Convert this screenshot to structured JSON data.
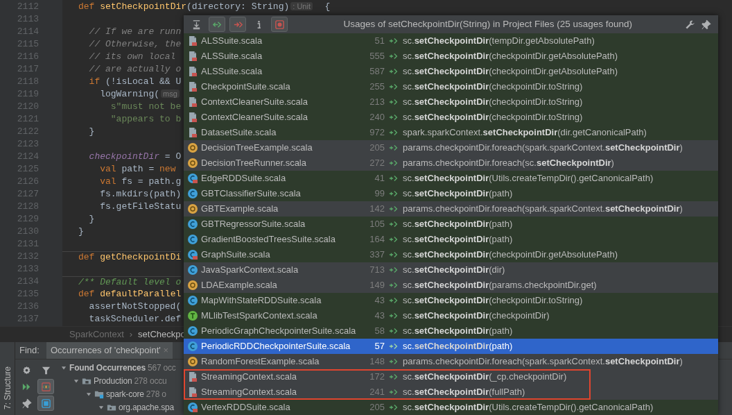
{
  "editor": {
    "lines": [
      {
        "number": "2112",
        "segments": [
          {
            "kind": "keyword",
            "text": "def "
          },
          {
            "kind": "function",
            "text": "setCheckpointDir"
          },
          {
            "kind": "plain",
            "text": "(directory: String)"
          },
          {
            "kind": "hint",
            "text": ": Unit"
          },
          {
            "kind": "plain",
            "text": "  {"
          }
        ]
      },
      {
        "number": "2113"
      },
      {
        "number": "2114",
        "segments": [
          {
            "kind": "comment",
            "text": "  // If we are runn"
          }
        ]
      },
      {
        "number": "2115",
        "segments": [
          {
            "kind": "comment",
            "text": "  // Otherwise, the"
          }
        ]
      },
      {
        "number": "2116",
        "segments": [
          {
            "kind": "comment",
            "text": "  // its own local"
          }
        ]
      },
      {
        "number": "2117",
        "segments": [
          {
            "kind": "comment",
            "text": "  // are actually o"
          }
        ]
      },
      {
        "number": "2118",
        "segments": [
          {
            "kind": "keyword",
            "text": "  if"
          },
          {
            "kind": "plain",
            "text": " (!isLocal && U"
          }
        ]
      },
      {
        "number": "2119",
        "segments": [
          {
            "kind": "plain",
            "text": "    logWarning("
          },
          {
            "kind": "hint",
            "text": "msg"
          }
        ]
      },
      {
        "number": "2120",
        "segments": [
          {
            "kind": "string",
            "text": "      s\"must not be"
          }
        ]
      },
      {
        "number": "2121",
        "segments": [
          {
            "kind": "string",
            "text": "      \"appears to b"
          }
        ]
      },
      {
        "number": "2122",
        "segments": [
          {
            "kind": "plain",
            "text": "  }"
          }
        ]
      },
      {
        "number": "2123"
      },
      {
        "number": "2124",
        "segments": [
          {
            "kind": "field",
            "text": "  checkpointDir"
          },
          {
            "kind": "plain",
            "text": " = O"
          }
        ]
      },
      {
        "number": "2125",
        "segments": [
          {
            "kind": "keyword",
            "text": "    val"
          },
          {
            "kind": "plain",
            "text": " path = "
          },
          {
            "kind": "keyword",
            "text": "new"
          }
        ]
      },
      {
        "number": "2126",
        "segments": [
          {
            "kind": "keyword",
            "text": "    val"
          },
          {
            "kind": "plain",
            "text": " fs = path.g"
          }
        ]
      },
      {
        "number": "2127",
        "segments": [
          {
            "kind": "plain",
            "text": "    fs.mkdirs(path)"
          }
        ]
      },
      {
        "number": "2128",
        "segments": [
          {
            "kind": "plain",
            "text": "    fs.getFileStatu"
          }
        ]
      },
      {
        "number": "2129",
        "segments": [
          {
            "kind": "plain",
            "text": "  }"
          }
        ]
      },
      {
        "number": "2130",
        "segments": [
          {
            "kind": "plain",
            "text": "}"
          }
        ]
      },
      {
        "number": "2131"
      },
      {
        "number": "2132",
        "separator": true,
        "segments": [
          {
            "kind": "keyword",
            "text": "def "
          },
          {
            "kind": "function",
            "text": "getCheckpointDi"
          }
        ]
      },
      {
        "number": "2133"
      },
      {
        "number": "2134",
        "separator": true,
        "segments": [
          {
            "kind": "doc",
            "text": "/** Default level o"
          }
        ]
      },
      {
        "number": "2135",
        "segments": [
          {
            "kind": "keyword",
            "text": "def "
          },
          {
            "kind": "function",
            "text": "defaultParallel"
          }
        ]
      },
      {
        "number": "2136",
        "segments": [
          {
            "kind": "plain",
            "text": "  assertNotStopped("
          }
        ]
      },
      {
        "number": "2137",
        "segments": [
          {
            "kind": "plain",
            "text": "  taskScheduler.def"
          }
        ]
      }
    ]
  },
  "breadcrumb": {
    "items": [
      "SparkContext",
      "setCheckpo"
    ],
    "separator": "›"
  },
  "find_panel": {
    "label": "Find:",
    "tab": {
      "title": "Occurrences of 'checkpoint'",
      "close": "×",
      "selected": true
    },
    "sidebar_label": "7: Structure",
    "toolbar": [
      {
        "kind": "settings",
        "selected": false
      },
      {
        "kind": "filter",
        "selected": false
      },
      {
        "kind": "rerun",
        "selected": false
      },
      {
        "kind": "preview",
        "selected": true
      },
      {
        "kind": "pin",
        "selected": false
      },
      {
        "kind": "autoscroll",
        "selected": true
      }
    ],
    "tree": [
      {
        "label": "Found Occurrences",
        "count": "567 occ",
        "expanded": true,
        "children": [
          {
            "label": "Production",
            "count": "278 occu",
            "kind": "folder",
            "expanded": true,
            "children": [
              {
                "label": "spark-core",
                "count": "278 o",
                "kind": "module",
                "expanded": true,
                "children": [
                  {
                    "label": "org.apache.spa",
                    "kind": "package",
                    "expanded": true
                  }
                ]
              }
            ]
          }
        ]
      }
    ]
  },
  "usages": {
    "title": "Usages of setCheckpointDir(String) in Project Files (25 usages found)",
    "toolbar": [
      {
        "kind": "expand",
        "selected": false
      },
      {
        "kind": "read",
        "selected": true
      },
      {
        "kind": "write",
        "selected": true
      },
      {
        "kind": "info",
        "selected": false
      },
      {
        "kind": "members",
        "selected": true
      }
    ],
    "rows": [
      {
        "file": "ALSSuite.scala",
        "kind": "file",
        "line": "51",
        "code": "sc.**setCheckpointDir**(tempDir.getAbsolutePath)",
        "test": true,
        "selected": false,
        "circled": false
      },
      {
        "file": "ALSSuite.scala",
        "kind": "file",
        "line": "555",
        "code": "sc.**setCheckpointDir**(checkpointDir.getAbsolutePath)",
        "test": true,
        "selected": false,
        "circled": false
      },
      {
        "file": "ALSSuite.scala",
        "kind": "file",
        "line": "587",
        "code": "sc.**setCheckpointDir**(checkpointDir.getAbsolutePath)",
        "test": true,
        "selected": false,
        "circled": false
      },
      {
        "file": "CheckpointSuite.scala",
        "kind": "file",
        "line": "255",
        "code": "sc.**setCheckpointDir**(checkpointDir.toString)",
        "test": true,
        "selected": false,
        "circled": false
      },
      {
        "file": "ContextCleanerSuite.scala",
        "kind": "file",
        "line": "213",
        "code": "sc.**setCheckpointDir**(checkpointDir.toString)",
        "test": true,
        "selected": false,
        "circled": false
      },
      {
        "file": "ContextCleanerSuite.scala",
        "kind": "file",
        "line": "240",
        "code": "sc.**setCheckpointDir**(checkpointDir.toString)",
        "test": true,
        "selected": false,
        "circled": false
      },
      {
        "file": "DatasetSuite.scala",
        "kind": "file",
        "line": "972",
        "code": "spark.sparkContext.**setCheckpointDir**(dir.getCanonicalPath)",
        "test": true,
        "selected": false,
        "circled": false
      },
      {
        "file": "DecisionTreeExample.scala",
        "kind": "object",
        "line": "205",
        "code": "params.checkpointDir.foreach(spark.sparkContext.**setCheckpointDir**)",
        "test": false,
        "selected": false,
        "circled": false
      },
      {
        "file": "DecisionTreeRunner.scala",
        "kind": "object",
        "line": "272",
        "code": "params.checkpointDir.foreach(sc.**setCheckpointDir**)",
        "test": false,
        "selected": false,
        "circled": false
      },
      {
        "file": "EdgeRDDSuite.scala",
        "kind": "testclass",
        "line": "41",
        "code": "sc.**setCheckpointDir**(Utils.createTempDir().getCanonicalPath)",
        "test": true,
        "selected": false,
        "circled": false
      },
      {
        "file": "GBTClassifierSuite.scala",
        "kind": "class",
        "line": "99",
        "code": "sc.**setCheckpointDir**(path)",
        "test": true,
        "selected": false,
        "circled": false
      },
      {
        "file": "GBTExample.scala",
        "kind": "object",
        "line": "142",
        "code": "params.checkpointDir.foreach(spark.sparkContext.**setCheckpointDir**)",
        "test": false,
        "selected": false,
        "circled": false
      },
      {
        "file": "GBTRegressorSuite.scala",
        "kind": "class",
        "line": "105",
        "code": "sc.**setCheckpointDir**(path)",
        "test": true,
        "selected": false,
        "circled": false
      },
      {
        "file": "GradientBoostedTreesSuite.scala",
        "kind": "class",
        "line": "164",
        "code": "sc.**setCheckpointDir**(path)",
        "test": true,
        "selected": false,
        "circled": false
      },
      {
        "file": "GraphSuite.scala",
        "kind": "testclass",
        "line": "337",
        "code": "sc.**setCheckpointDir**(checkpointDir.getAbsolutePath)",
        "test": true,
        "selected": false,
        "circled": false
      },
      {
        "file": "JavaSparkContext.scala",
        "kind": "class",
        "line": "713",
        "code": "sc.**setCheckpointDir**(dir)",
        "test": false,
        "selected": false,
        "circled": false
      },
      {
        "file": "LDAExample.scala",
        "kind": "object",
        "line": "149",
        "code": "sc.**setCheckpointDir**(params.checkpointDir.get)",
        "test": false,
        "selected": false,
        "circled": false
      },
      {
        "file": "MapWithStateRDDSuite.scala",
        "kind": "class",
        "line": "43",
        "code": "sc.**setCheckpointDir**(checkpointDir.toString)",
        "test": true,
        "selected": false,
        "circled": false
      },
      {
        "file": "MLlibTestSparkContext.scala",
        "kind": "trait",
        "line": "43",
        "code": "sc.**setCheckpointDir**(checkpointDir)",
        "test": true,
        "selected": false,
        "circled": false
      },
      {
        "file": "PeriodicGraphCheckpointerSuite.scala",
        "kind": "class",
        "line": "58",
        "code": "sc.**setCheckpointDir**(path)",
        "test": true,
        "selected": false,
        "circled": false
      },
      {
        "file": "PeriodicRDDCheckpointerSuite.scala",
        "kind": "class",
        "line": "57",
        "code": "sc.**setCheckpointDir**(path)",
        "test": true,
        "selected": true,
        "circled": false
      },
      {
        "file": "RandomForestExample.scala",
        "kind": "object",
        "line": "148",
        "code": "params.checkpointDir.foreach(spark.sparkContext.**setCheckpointDir**)",
        "test": false,
        "selected": false,
        "circled": false
      },
      {
        "file": "StreamingContext.scala",
        "kind": "file",
        "line": "172",
        "code": "sc.**setCheckpointDir**(_cp.checkpointDir)",
        "test": false,
        "selected": false,
        "circled": true
      },
      {
        "file": "StreamingContext.scala",
        "kind": "file",
        "line": "241",
        "code": "sc.**setCheckpointDir**(fullPath)",
        "test": false,
        "selected": false,
        "circled": true
      },
      {
        "file": "VertexRDDSuite.scala",
        "kind": "testclass",
        "line": "205",
        "code": "sc.**setCheckpointDir**(Utils.createTempDir().getCanonicalPath)",
        "test": true,
        "selected": false,
        "circled": false
      }
    ]
  }
}
